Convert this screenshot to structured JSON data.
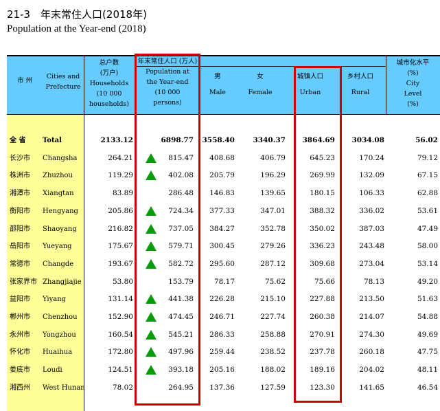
{
  "title": {
    "cn": "21-3　年末常住人口(2018年)",
    "en": "Population at the Year-end (2018)"
  },
  "headers": {
    "city_cn": "市 州",
    "city_en": [
      "Cities and",
      "Prefecture"
    ],
    "households": [
      "总户数",
      "(万户)",
      "Households",
      "(10 000",
      "households)"
    ],
    "population": [
      "年末常住人口 (万人)",
      "Population at",
      "the Year-end",
      "(10 000",
      "persons)"
    ],
    "male": [
      "男",
      "Male"
    ],
    "female": [
      "女",
      "Female"
    ],
    "urban": [
      "城镇人口",
      "Urban"
    ],
    "rural": [
      "乡村人口",
      "Rural"
    ],
    "level": [
      "城市化水平",
      "(%)",
      "City",
      "Level",
      "(%)"
    ]
  },
  "rows": [
    {
      "cn": "全 省",
      "en": "Total",
      "hh": "2133.12",
      "pop": "6898.77",
      "male": "3558.40",
      "female": "3340.37",
      "urban": "3864.69",
      "rural": "3034.08",
      "level": "56.02",
      "tri": false,
      "bold": true
    },
    {
      "cn": "长沙市",
      "en": "Changsha",
      "hh": "264.21",
      "pop": "815.47",
      "male": "408.68",
      "female": "406.79",
      "urban": "645.23",
      "rural": "170.24",
      "level": "79.12",
      "tri": true,
      "bold": false
    },
    {
      "cn": "株洲市",
      "en": "Zhuzhou",
      "hh": "119.29",
      "pop": "402.08",
      "male": "205.79",
      "female": "196.29",
      "urban": "269.99",
      "rural": "132.09",
      "level": "67.15",
      "tri": true,
      "bold": false
    },
    {
      "cn": "湘潭市",
      "en": "Xiangtan",
      "hh": "83.89",
      "pop": "286.48",
      "male": "146.83",
      "female": "139.65",
      "urban": "180.15",
      "rural": "106.33",
      "level": "62.88",
      "tri": false,
      "bold": false
    },
    {
      "cn": "衡阳市",
      "en": "Hengyang",
      "hh": "205.86",
      "pop": "724.34",
      "male": "377.33",
      "female": "347.01",
      "urban": "388.32",
      "rural": "336.02",
      "level": "53.61",
      "tri": true,
      "bold": false
    },
    {
      "cn": "邵阳市",
      "en": "Shaoyang",
      "hh": "216.82",
      "pop": "737.05",
      "male": "384.27",
      "female": "352.78",
      "urban": "350.02",
      "rural": "387.03",
      "level": "47.49",
      "tri": true,
      "bold": false
    },
    {
      "cn": "岳阳市",
      "en": "Yueyang",
      "hh": "175.67",
      "pop": "579.71",
      "male": "300.45",
      "female": "279.26",
      "urban": "336.23",
      "rural": "243.48",
      "level": "58.00",
      "tri": true,
      "bold": false
    },
    {
      "cn": "常德市",
      "en": "Changde",
      "hh": "193.67",
      "pop": "582.72",
      "male": "295.60",
      "female": "287.12",
      "urban": "309.68",
      "rural": "273.04",
      "level": "53.14",
      "tri": true,
      "bold": false
    },
    {
      "cn": "张家界市",
      "en": "Zhangjiajie",
      "hh": "53.80",
      "pop": "153.79",
      "male": "78.17",
      "female": "75.62",
      "urban": "75.66",
      "rural": "78.13",
      "level": "49.20",
      "tri": false,
      "bold": false
    },
    {
      "cn": "益阳市",
      "en": "Yiyang",
      "hh": "131.14",
      "pop": "441.38",
      "male": "226.28",
      "female": "215.10",
      "urban": "227.88",
      "rural": "213.50",
      "level": "51.63",
      "tri": true,
      "bold": false
    },
    {
      "cn": "郴州市",
      "en": "Chenzhou",
      "hh": "152.90",
      "pop": "474.45",
      "male": "246.71",
      "female": "227.74",
      "urban": "260.38",
      "rural": "214.07",
      "level": "54.88",
      "tri": true,
      "bold": false
    },
    {
      "cn": "永州市",
      "en": "Yongzhou",
      "hh": "160.54",
      "pop": "545.21",
      "male": "286.33",
      "female": "258.88",
      "urban": "270.91",
      "rural": "274.30",
      "level": "49.69",
      "tri": true,
      "bold": false
    },
    {
      "cn": "怀化市",
      "en": "Huaihua",
      "hh": "172.80",
      "pop": "497.96",
      "male": "259.44",
      "female": "238.52",
      "urban": "237.78",
      "rural": "260.18",
      "level": "47.75",
      "tri": true,
      "bold": false
    },
    {
      "cn": "娄底市",
      "en": "Loudi",
      "hh": "124.51",
      "pop": "393.18",
      "male": "205.16",
      "female": "188.02",
      "urban": "189.16",
      "rural": "204.02",
      "level": "48.11",
      "tri": true,
      "bold": false
    },
    {
      "cn": "湘西州",
      "en": "West Hunan",
      "hh": "78.02",
      "pop": "264.95",
      "male": "137.36",
      "female": "127.59",
      "urban": "123.30",
      "rural": "141.65",
      "level": "46.54",
      "tri": false,
      "bold": false
    }
  ],
  "colors": {
    "header_bg": "#66ccff",
    "first_col_bg": "#ffff99",
    "highlight_box": "#cc0000",
    "triangle": "#0a9a0a"
  }
}
